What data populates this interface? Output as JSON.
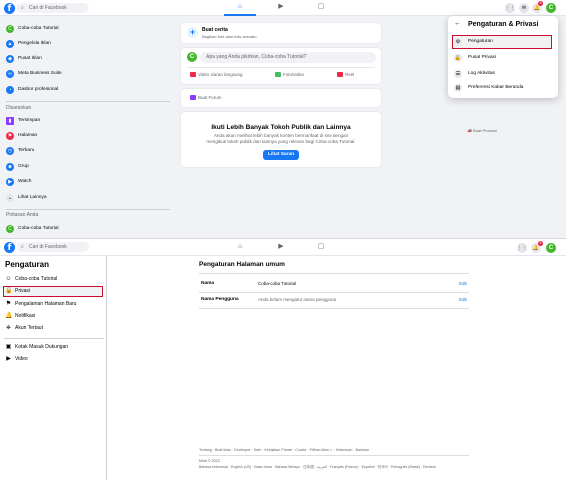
{
  "top": {
    "search_placeholder": "Cari di Facebook",
    "notif_count": "5",
    "avatar_letter": "C",
    "sidebar": {
      "profile": "Coba-coba Tutorial",
      "tools": [
        {
          "label": "Pengelola Iklan",
          "color": "#1877f2"
        },
        {
          "label": "Pusat Iklan",
          "color": "#1877f2"
        },
        {
          "label": "Meta Business Suite",
          "color": "#1877f2"
        },
        {
          "label": "Dasbor profesional",
          "color": "#1877f2"
        }
      ],
      "suggested_heading": "Disarankan",
      "suggested": [
        {
          "label": "Tersimpan",
          "color": "#8b3dff"
        },
        {
          "label": "Halaman",
          "color": "#f02849"
        },
        {
          "label": "Terbaru",
          "color": "#1877f2"
        },
        {
          "label": "Grup",
          "color": "#1877f2"
        },
        {
          "label": "Watch",
          "color": "#1877f2"
        },
        {
          "label": "Lihat Lainnya",
          "color": "#e4e6eb"
        }
      ],
      "shortcuts_heading": "Pintasan Anda",
      "shortcut": "Coba-coba Tutorial"
    },
    "story": {
      "title": "Buat cerita",
      "subtitle": "Bagikan foto atau tulis sesuatu."
    },
    "composer": {
      "placeholder": "Apa yang Anda pikirkan, Coba-coba Tutorial?",
      "actions": [
        {
          "label": "Video siaran langsung",
          "color": "#f02849"
        },
        {
          "label": "Foto/video",
          "color": "#45bd62"
        },
        {
          "label": "Reel",
          "color": "#f02849"
        }
      ]
    },
    "create_forum": "Buat Forum",
    "follow": {
      "title": "Ikuti Lebih Banyak Tokoh Publik dan Lainnya",
      "desc": "Anda akan melihat lebih banyak konten bermanfaat di sini dengan mengikuti tokoh publik dan lainnya yang relevan bagi Coba-coba Tutorial.",
      "button": "Lihat Saran"
    },
    "buat_promosi": "Buat Promosi",
    "dropdown": {
      "back": "←",
      "title": "Pengaturan & Privasi",
      "items": [
        {
          "label": "Pengaturan",
          "icon": "⚙"
        },
        {
          "label": "Pusat Privasi",
          "icon": "🔒"
        },
        {
          "label": "Log Aktivitas",
          "icon": "☰"
        },
        {
          "label": "Preferensi Kabar Beranda",
          "icon": "▤"
        }
      ]
    }
  },
  "bottom": {
    "search_placeholder": "Cari di Facebook",
    "notif_count": "5",
    "avatar_letter": "C",
    "sidebar_title": "Pengaturan",
    "items": [
      {
        "label": "Coba-coba Tutorial",
        "icon": "☺"
      },
      {
        "label": "Privasi",
        "icon": "🔒"
      },
      {
        "label": "Pengalaman Halaman Baru",
        "icon": "⚑"
      },
      {
        "label": "Notifikasi",
        "icon": "🔔"
      },
      {
        "label": "Akun Tertaut",
        "icon": "⎈"
      },
      {
        "label": "Kotak Masuk Dukungan",
        "icon": "▣"
      },
      {
        "label": "Video",
        "icon": "▶"
      }
    ],
    "main_title": "Pengaturan Halaman umum",
    "rows": [
      {
        "label": "Nama",
        "value": "Coba-coba Tutorial",
        "edit": "Edit"
      },
      {
        "label": "Nama Pengguna",
        "value": "Anda belum mengatur nama pengguna",
        "edit": "Edit"
      }
    ],
    "footer_links": "Tentang · Buat Iklan · Developer · Karir · Kebijakan Privasi · Cookie · Pilihan Iklan ▷ · Ketentuan · Bantuan",
    "footer_copy": "Meta © 2023",
    "footer_langs": "Bahasa Indonesia · English (US) · Basa Jawa · Bahasa Melayu · 日本語 · العربية · Français (France) · Español · 한국어 · Português (Brasil) · Deutsch"
  }
}
